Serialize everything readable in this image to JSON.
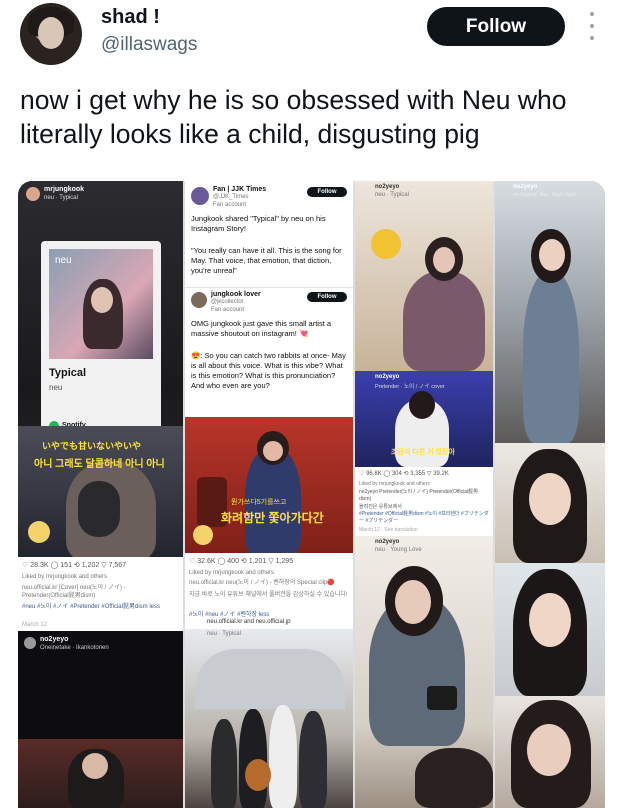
{
  "tweet": {
    "display_name": "shad !",
    "handle": "@illaswags",
    "follow_label": "Follow",
    "text": "now i get why he is so obsessed with Neu who literally looks like a child, disgusting pig"
  },
  "collage": {
    "col1": {
      "account": "mrjungkook",
      "song": "neu · Typical",
      "album_title": "Typical",
      "album_artist": "neu",
      "album_logo": "neu",
      "player": "Spotify",
      "caption_jp": "いやでも甘いないやいや",
      "caption_kr": "아니 그래도 달콤하네 아니 아니",
      "likes": "28.3K",
      "comments": "151",
      "reposts": "1,202",
      "shares": "7,567",
      "liked_by": "Liked by mrjungkook and others",
      "post_text": "neu.official.kr [Cover] neu(노이 / ノイ) - Pretender(Official髭男dism)",
      "tags": "#neu #노이 #ノイ #Pretender #Official髭男dism less",
      "date": "March 12",
      "bottom_account": "no2yeyo",
      "bottom_song": "Oneinetake · Ikankotonen"
    },
    "col2": {
      "fan_name": "Fan | JJK Times",
      "fan_handle": "@JJK_Times",
      "fan_badge": "Fan account",
      "follow_label": "Follow",
      "post1": "Jungkook shared \"Typical\" by neu on his Instagram Story!",
      "quote": "\"You really can have it all. This is the song for May. That voice, that emotion, that diction, you're unreal\"",
      "reply_name": "jungkook lover",
      "reply_handle": "@jkcollector",
      "reply_badge": "Fan account",
      "reply_text": "OMG jungkook just gave this small artist a massive shoutout on instagram! 💘",
      "reply_text2": "😍: So you can catch two rabbits at once- May is all about this voice. What is this vibe? What is this emotion? What is this pronunciation? And who even are you?",
      "video_caption_top": "뭔가쓰다5기를쓰고",
      "video_caption": "화려함만 쫓아가다간",
      "likes": "32.6K",
      "comments": "400",
      "reposts": "1,201",
      "shares": "1,295",
      "liked_by": "Liked by mrjungkook and others",
      "post_text": "neu.official.kr neu(노이 / ノイ) - 벤하장의 Special clip🔴",
      "post_text_kr": "지금 바로 노이 유튜브 채널에서 풀버전을 감상하실 수 있습니다!",
      "tags": "#노이 #neu #ノイ #벤하장 less",
      "collab": "neu.official.kr and neu.official.jp",
      "collab_sub": "neu · Typical"
    },
    "col3": {
      "top_account": "no2yeyo",
      "top_song": "neu · Typical",
      "mid_account": "no2yeyo",
      "mid_song": "Pretender · 노이 / ノイ cover",
      "mid_caption": "조금이 다른 거 있잖아",
      "likes": "96.8K",
      "comments": "304",
      "reposts": "3,355",
      "shares": "39.2K",
      "liked_by": "Liked by mrjungkook and others",
      "post_text": "no2yeyo Pretender(노이 / ノイ) Pretender(Official髭男dism)",
      "post_text2": "올려진은 유튜브에서",
      "tags": "#Pretender #Official髭男dism #노이 #프리텐더 #ブリテンダー #プリテンダー",
      "date": "March 12 · See translation",
      "bottom_account": "no2yeyo",
      "bottom_song": "neu · Young Love"
    },
    "col4": {
      "account": "no2yeyo",
      "song": "no Original Star · Rock Spot"
    }
  },
  "colors": {
    "follow_bg": "#0f1419",
    "handle": "#536471",
    "spotify": "#1db954",
    "verified": "#1d9bf0"
  }
}
